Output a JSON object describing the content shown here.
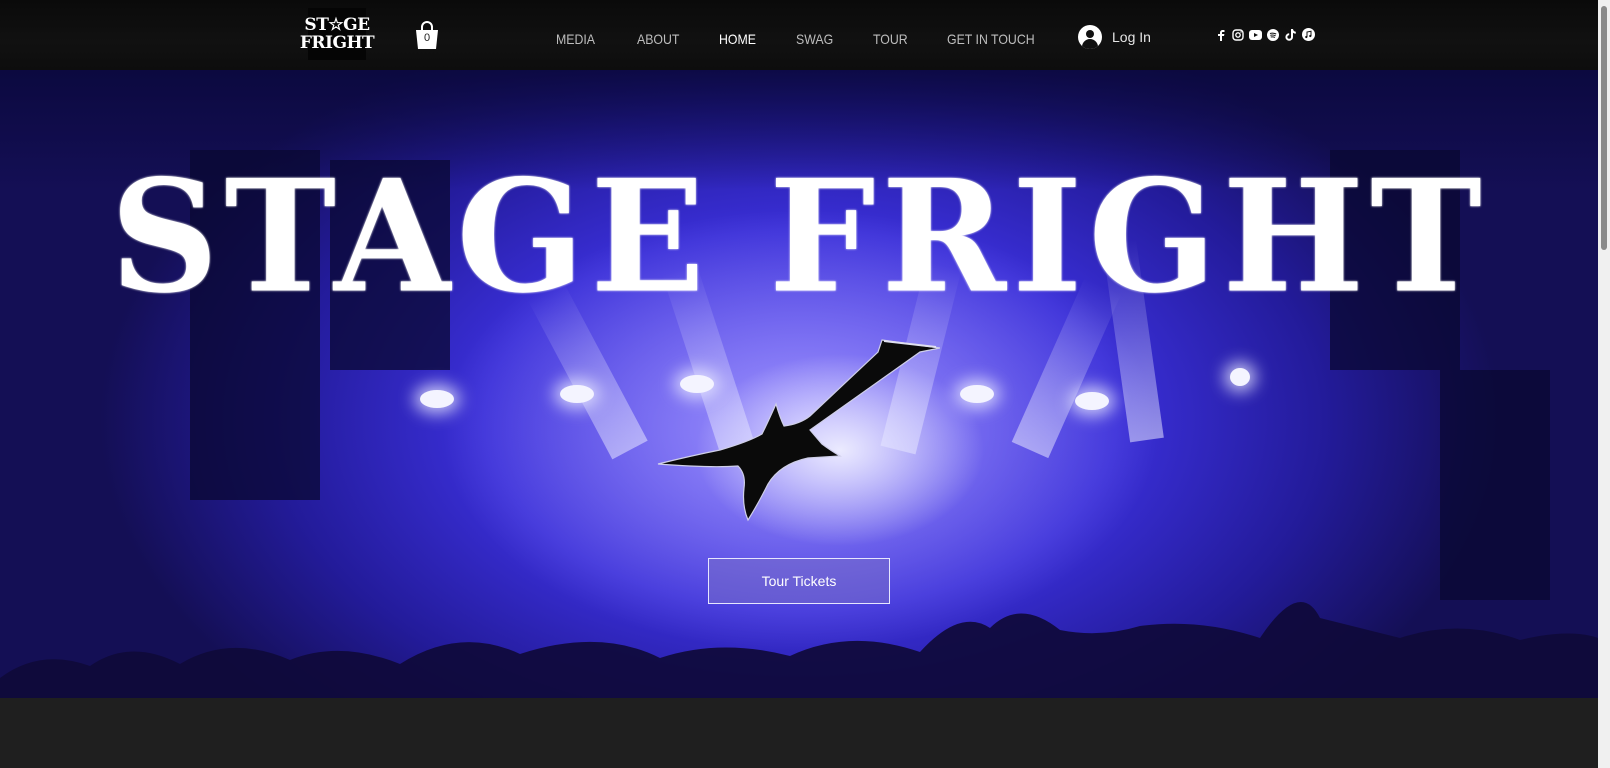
{
  "header": {
    "logo": {
      "line1": "ST☆GE",
      "line2": "FRIGHT"
    },
    "cart": {
      "count": "0"
    },
    "nav": [
      {
        "label": "MEDIA",
        "active": false
      },
      {
        "label": "ABOUT",
        "active": false
      },
      {
        "label": "HOME",
        "active": true
      },
      {
        "label": "SWAG",
        "active": false
      },
      {
        "label": "TOUR",
        "active": false
      },
      {
        "label": "GET IN TOUCH",
        "active": false
      }
    ],
    "login": {
      "label": "Log In"
    },
    "social": [
      "facebook-icon",
      "instagram-icon",
      "youtube-icon",
      "spotify-icon",
      "tiktok-icon",
      "apple-music-icon"
    ]
  },
  "hero": {
    "title": "STAGE FRIGHT",
    "cta": "Tour Tickets"
  },
  "colors": {
    "header_bg": "#0d0d0d",
    "hero_purple": "#3a2fd8",
    "nav_inactive": "#bdbdbd",
    "nav_active": "#ffffff"
  }
}
